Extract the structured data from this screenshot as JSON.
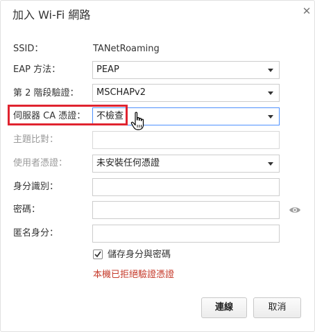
{
  "dialog": {
    "title": "加入 Wi-Fi 網路",
    "close_label": "✕"
  },
  "fields": {
    "ssid_label": "SSID：",
    "ssid_value": "TANetRoaming",
    "eap_label": "EAP 方法：",
    "eap_value": "PEAP",
    "phase2_label": "第 2 階段驗證：",
    "phase2_value": "MSCHAPv2",
    "server_ca_label": "伺服器 CA 憑證：",
    "server_ca_value": "不檢查",
    "subject_match_label": "主題比對：",
    "subject_match_value": "",
    "user_cert_label": "使用者憑證：",
    "user_cert_value": "未安裝任何憑證",
    "identity_label": "身分識別：",
    "identity_value": "",
    "password_label": "密碼：",
    "password_value": "",
    "anonymous_label": "匿名身分：",
    "anonymous_value": ""
  },
  "save_identity": {
    "label": "儲存身分與密碼",
    "checked": true
  },
  "error_message": "本機已拒絕驗證憑證",
  "buttons": {
    "connect": "連線",
    "cancel": "取消"
  },
  "colors": {
    "highlight": "#e0232f",
    "error": "#c53929",
    "focus": "#4d90fe"
  },
  "icons": {
    "close": "close-icon",
    "eye": "eye-icon",
    "checkbox": "checkmark-icon",
    "cursor": "hand-cursor-icon"
  }
}
